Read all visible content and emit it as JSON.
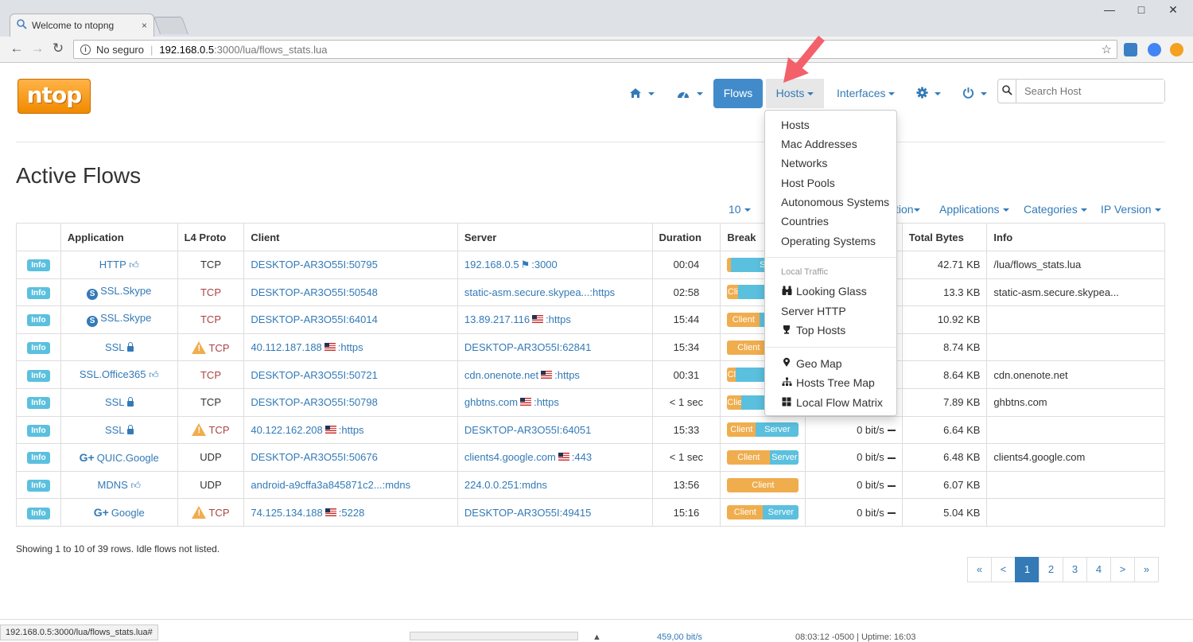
{
  "browser": {
    "tab_title": "Welcome to ntopng",
    "tab_close": "×",
    "security_label": "No seguro",
    "url_host": "192.168.0.5",
    "url_path": ":3000/lua/flows_stats.lua",
    "status_url": "192.168.0.5:3000/lua/flows_stats.lua#"
  },
  "nav": {
    "logo": "ntop",
    "flows": "Flows",
    "hosts": "Hosts",
    "interfaces": "Interfaces",
    "search_placeholder": "Search Host"
  },
  "dropdown": {
    "items": [
      "Hosts",
      "Mac Addresses",
      "Networks",
      "Host Pools",
      "Autonomous Systems",
      "Countries",
      "Operating Systems"
    ],
    "local_header": "Local Traffic",
    "local_items": [
      "Looking Glass",
      "Server HTTP",
      "Top Hosts"
    ],
    "map_items": [
      "Geo Map",
      "Hosts Tree Map",
      "Local Flow Matrix"
    ]
  },
  "page": {
    "title": "Active Flows",
    "filters": {
      "rows": "10",
      "direction": "ction",
      "applications": "Applications",
      "categories": "Categories",
      "ip_version": "IP Version"
    }
  },
  "table": {
    "headers": [
      "",
      "Application",
      "L4 Proto",
      "Client",
      "Server",
      "Duration",
      "Break",
      "ot",
      "Total Bytes",
      "Info"
    ],
    "info_label": "Info",
    "rows": [
      {
        "app": "HTTP",
        "app_icon": "thumbs-up",
        "proto": "TCP",
        "warn": false,
        "client": "DESKTOP-AR3O55I:50795",
        "server": "192.168.0.5",
        "server_suffix": ":3000",
        "server_flag": "local",
        "duration": "00:04",
        "client_pct": 0.05,
        "client_label": "",
        "server_label": "Se",
        "thpt": "it/s",
        "bytes": "42.71 KB",
        "info": "/lua/flows_stats.lua"
      },
      {
        "app": "SSL.Skype",
        "app_icon": "skype",
        "proto": "TCP",
        "warn": false,
        "client": "DESKTOP-AR3O55I:50548",
        "server": "static-asm.secure.skypea...:https",
        "server_suffix": "",
        "server_flag": "",
        "duration": "02:58",
        "client_pct": 0.15,
        "client_label": "Cli",
        "server_label": "",
        "thpt": "",
        "bytes": "13.3 KB",
        "info": "static-asm.secure.skypea..."
      },
      {
        "app": "SSL.Skype",
        "app_icon": "skype",
        "proto": "TCP",
        "warn": false,
        "client": "DESKTOP-AR3O55I:64014",
        "server": "13.89.217.116",
        "server_suffix": ":https",
        "server_flag": "us",
        "duration": "15:44",
        "client_pct": 0.45,
        "client_label": "Client",
        "server_label": "",
        "thpt": "",
        "bytes": "10.92 KB",
        "info": ""
      },
      {
        "app": "SSL",
        "app_icon": "lock",
        "proto": "TCP",
        "warn": true,
        "client": "40.112.187.188",
        "client_flag": "us",
        "client_suffix": ":https",
        "server": "DESKTOP-AR3O55I:62841",
        "server_suffix": "",
        "server_flag": "",
        "duration": "15:34",
        "client_pct": 0.6,
        "client_label": "Client",
        "server_label": "",
        "thpt": "",
        "bytes": "8.74 KB",
        "info": ""
      },
      {
        "app": "SSL.Office365",
        "app_icon": "thumbs-up",
        "proto": "TCP",
        "warn": false,
        "client": "DESKTOP-AR3O55I:50721",
        "server": "cdn.onenote.net",
        "server_suffix": ":https",
        "server_flag": "us",
        "duration": "00:31",
        "client_pct": 0.12,
        "client_label": "Cl",
        "server_label": "",
        "thpt": "",
        "bytes": "8.64 KB",
        "info": "cdn.onenote.net"
      },
      {
        "app": "SSL",
        "app_icon": "lock",
        "proto": "TCP",
        "warn": false,
        "client": "DESKTOP-AR3O55I:50798",
        "server": "ghbtns.com",
        "server_suffix": ":https",
        "server_flag": "us",
        "duration": "< 1 sec",
        "client_pct": 0.2,
        "client_label": "Clie",
        "server_label": "S",
        "thpt": "",
        "bytes": "7.89 KB",
        "info": "ghbtns.com"
      },
      {
        "app": "SSL",
        "app_icon": "lock",
        "proto": "TCP",
        "warn": true,
        "client": "40.122.162.208",
        "client_flag": "us",
        "client_suffix": ":https",
        "server": "DESKTOP-AR3O55I:64051",
        "server_suffix": "",
        "server_flag": "",
        "duration": "15:33",
        "client_pct": 0.4,
        "client_label": "Client",
        "server_label": "Server",
        "thpt": "0 bit/s",
        "bytes": "6.64 KB",
        "info": ""
      },
      {
        "app": "QUIC.Google",
        "app_icon": "gplus",
        "proto": "UDP",
        "warn": false,
        "client": "DESKTOP-AR3O55I:50676",
        "server": "clients4.google.com",
        "server_suffix": ":443",
        "server_flag": "us",
        "duration": "< 1 sec",
        "client_pct": 0.6,
        "client_label": "Client",
        "server_label": "Server",
        "thpt": "0 bit/s",
        "bytes": "6.48 KB",
        "info": "clients4.google.com"
      },
      {
        "app": "MDNS",
        "app_icon": "thumbs-up",
        "proto": "UDP",
        "warn": false,
        "client": "android-a9cffa3a845871c2...:mdns",
        "server": "224.0.0.251:mdns",
        "server_suffix": "",
        "server_flag": "",
        "duration": "13:56",
        "client_pct": 1.0,
        "client_label": "Client",
        "server_label": "",
        "thpt": "0 bit/s",
        "bytes": "6.07 KB",
        "info": ""
      },
      {
        "app": "Google",
        "app_icon": "gplus",
        "proto": "TCP",
        "warn": true,
        "client": "74.125.134.188",
        "client_flag": "us",
        "client_suffix": ":5228",
        "server": "DESKTOP-AR3O55I:49415",
        "server_suffix": "",
        "server_flag": "",
        "duration": "15:16",
        "client_pct": 0.5,
        "client_label": "Client",
        "server_label": "Server",
        "thpt": "0 bit/s",
        "bytes": "5.04 KB",
        "info": ""
      }
    ]
  },
  "summary": "Showing 1 to 10 of 39 rows. Idle flows not listed.",
  "pagination": [
    "«",
    "<",
    "1",
    "2",
    "3",
    "4",
    ">",
    "»"
  ],
  "pagination_active": "1",
  "footer": {
    "traffic": "459,00 bit/s",
    "clock": "08:03:12 -0500 | Uptime: 16:03"
  },
  "colors": {
    "client_bar": "#f0ad4e",
    "server_bar": "#5bc0de",
    "link": "#337ab7",
    "active_nav": "#428bca",
    "annotation_arrow": "#f4606a"
  }
}
